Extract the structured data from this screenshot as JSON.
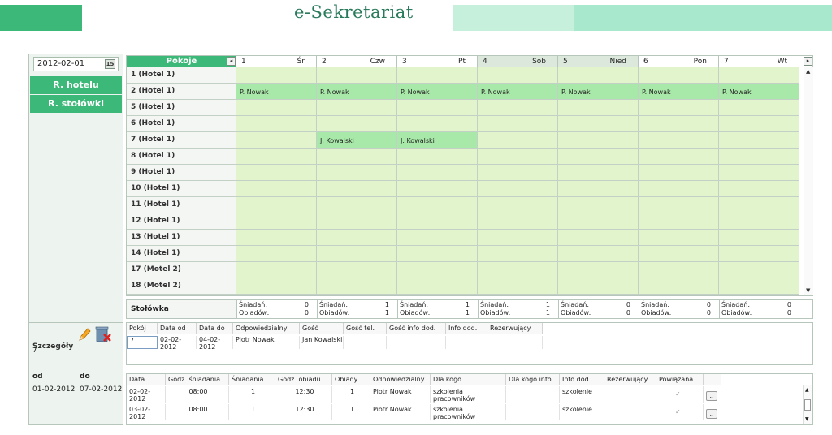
{
  "app": {
    "title": "e-Sekretariat"
  },
  "header": {
    "colors": [
      "#3cb878",
      "#ffffff",
      "#ffffff",
      "#a8e8cc",
      "#c6f0dc",
      "#a8e8cc"
    ]
  },
  "sidebar": {
    "date": "2012-02-01",
    "calendar_icon_label": "15",
    "hotel_button": "R. hotelu",
    "canteen_button": "R. stołówki"
  },
  "grid": {
    "rooms_header": "Pokoje",
    "days": [
      {
        "n": "1",
        "d": "Śr"
      },
      {
        "n": "2",
        "d": "Czw"
      },
      {
        "n": "3",
        "d": "Pt"
      },
      {
        "n": "4",
        "d": "Sob"
      },
      {
        "n": "5",
        "d": "Nied"
      },
      {
        "n": "6",
        "d": "Pon"
      },
      {
        "n": "7",
        "d": "Wt"
      }
    ],
    "rows": [
      {
        "room": "1  (Hotel 1)",
        "cells": [
          "",
          "",
          "",
          "",
          "",
          "",
          ""
        ]
      },
      {
        "room": "2  (Hotel 1)",
        "cells": [
          "P. Nowak",
          "P. Nowak",
          "P. Nowak",
          "P. Nowak",
          "P. Nowak",
          "P. Nowak",
          "P. Nowak"
        ]
      },
      {
        "room": "5  (Hotel 1)",
        "cells": [
          "",
          "",
          "",
          "",
          "",
          "",
          ""
        ]
      },
      {
        "room": "6  (Hotel 1)",
        "cells": [
          "",
          "",
          "",
          "",
          "",
          "",
          ""
        ]
      },
      {
        "room": "7  (Hotel 1)",
        "cells": [
          "",
          "J. Kowalski",
          "J. Kowalski",
          "",
          "",
          "",
          ""
        ]
      },
      {
        "room": "8  (Hotel 1)",
        "cells": [
          "",
          "",
          "",
          "",
          "",
          "",
          ""
        ]
      },
      {
        "room": "9  (Hotel 1)",
        "cells": [
          "",
          "",
          "",
          "",
          "",
          "",
          ""
        ]
      },
      {
        "room": "10  (Hotel 1)",
        "cells": [
          "",
          "",
          "",
          "",
          "",
          "",
          ""
        ]
      },
      {
        "room": "11  (Hotel 1)",
        "cells": [
          "",
          "",
          "",
          "",
          "",
          "",
          ""
        ]
      },
      {
        "room": "12  (Hotel 1)",
        "cells": [
          "",
          "",
          "",
          "",
          "",
          "",
          ""
        ]
      },
      {
        "room": "13  (Hotel 1)",
        "cells": [
          "",
          "",
          "",
          "",
          "",
          "",
          ""
        ]
      },
      {
        "room": "14  (Hotel 1)",
        "cells": [
          "",
          "",
          "",
          "",
          "",
          "",
          ""
        ]
      },
      {
        "room": "17  (Motel 2)",
        "cells": [
          "",
          "",
          "",
          "",
          "",
          "",
          ""
        ]
      },
      {
        "room": "18  (Motel 2)",
        "cells": [
          "",
          "",
          "",
          "",
          "",
          "",
          ""
        ]
      }
    ]
  },
  "canteen": {
    "label": "Stołówka",
    "breakfast_label": "Śniadań:",
    "dinner_label": "Obiadów:",
    "values": [
      {
        "b": "0",
        "o": "0"
      },
      {
        "b": "1",
        "o": "1"
      },
      {
        "b": "1",
        "o": "1"
      },
      {
        "b": "1",
        "o": "1"
      },
      {
        "b": "0",
        "o": "0"
      },
      {
        "b": "0",
        "o": "0"
      },
      {
        "b": "0",
        "o": "0"
      }
    ]
  },
  "details": {
    "title": "Szczegóły",
    "id": "7",
    "from_label": "od",
    "to_label": "do",
    "from": "01-02-2012",
    "to": "07-02-2012",
    "booking_headers": [
      "Pokój",
      "Data od",
      "Data do",
      "Odpowiedzialny",
      "Gość",
      "Gość tel.",
      "Gość info dod.",
      "Info dod.",
      "Rezerwujący"
    ],
    "booking_row": [
      "7",
      "02-02-2012",
      "04-02-2012",
      "Piotr Nowak",
      "Jan  Kowalski",
      "",
      "",
      "",
      ""
    ],
    "meal_headers": [
      "Data",
      "Godz. śniadania",
      "Śniadania",
      "Godz. obiadu",
      "Obiady",
      "Odpowiedzialny",
      "Dla kogo",
      "Dla kogo info",
      "Info dod.",
      "Rezerwujący",
      "Powiązana",
      ".."
    ],
    "meal_rows": [
      [
        "02-02-2012",
        "08:00",
        "1",
        "12:30",
        "1",
        "Piotr Nowak",
        "szkolenia pracowników",
        "",
        "szkolenie",
        "",
        "✓",
        ".."
      ],
      [
        "03-02-2012",
        "08:00",
        "1",
        "12:30",
        "1",
        "Piotr Nowak",
        "szkolenia pracowników",
        "",
        "szkolenie",
        "",
        "✓",
        ".."
      ]
    ]
  }
}
